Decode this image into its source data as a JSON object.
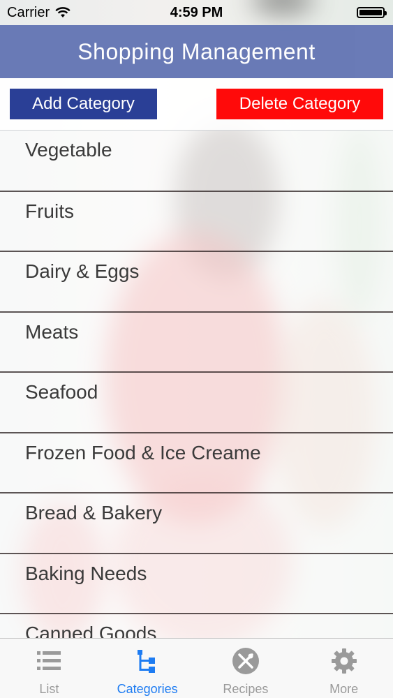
{
  "status_bar": {
    "carrier": "Carrier",
    "time": "4:59 PM"
  },
  "nav": {
    "title": "Shopping Management"
  },
  "actions": {
    "add_label": "Add Category",
    "delete_label": "Delete Category"
  },
  "categories": [
    "Vegetable",
    "Fruits",
    "Dairy & Eggs",
    "Meats",
    "Seafood",
    "Frozen Food & Ice Creame",
    "Bread & Bakery",
    "Baking Needs",
    "Canned Goods"
  ],
  "tabs": [
    {
      "label": "List",
      "icon": "list-icon"
    },
    {
      "label": "Categories",
      "icon": "categories-icon"
    },
    {
      "label": "Recipes",
      "icon": "utensils-icon"
    },
    {
      "label": "More",
      "icon": "gear-icon"
    }
  ],
  "colors": {
    "nav_bar": "#6577b5",
    "add_button": "#2a3f96",
    "delete_button": "#ff0a0a",
    "tab_active": "#1e7cf2",
    "tab_inactive": "#9a9a9a"
  }
}
